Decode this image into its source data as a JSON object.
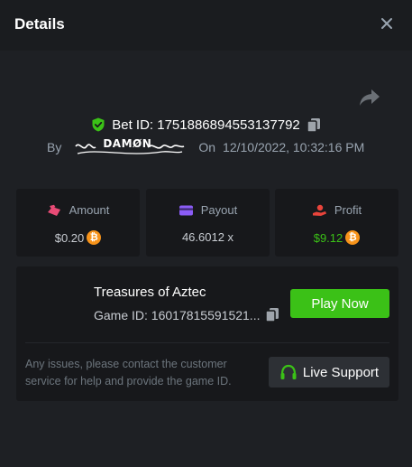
{
  "header": {
    "title": "Details"
  },
  "bet": {
    "id_label": "Bet ID: 1751886894553137792",
    "by_label": "By",
    "username": "DAMØN",
    "on_label": "On",
    "datetime": "12/10/2022, 10:32:16 PM"
  },
  "stats": [
    {
      "label": "Amount",
      "value": "$0.20",
      "icon": "amount-icon",
      "coin": "bitcoin-icon"
    },
    {
      "label": "Payout",
      "value": "46.6012 x",
      "icon": "payout-card-icon"
    },
    {
      "label": "Profit",
      "value": "$9.12",
      "icon": "profit-hand-icon",
      "coin": "bitcoin-icon"
    }
  ],
  "game": {
    "name": "Treasures of Aztec",
    "id_text": "Game ID: 16017815591521...",
    "play_label": "Play Now"
  },
  "support": {
    "help_text": "Any issues, please contact the customer service for help and provide the game ID.",
    "button_label": "Live Support"
  },
  "colors": {
    "accent_green": "#3bc117",
    "bitcoin": "#f7931a",
    "background": "#1e2024",
    "card": "#17181b"
  }
}
